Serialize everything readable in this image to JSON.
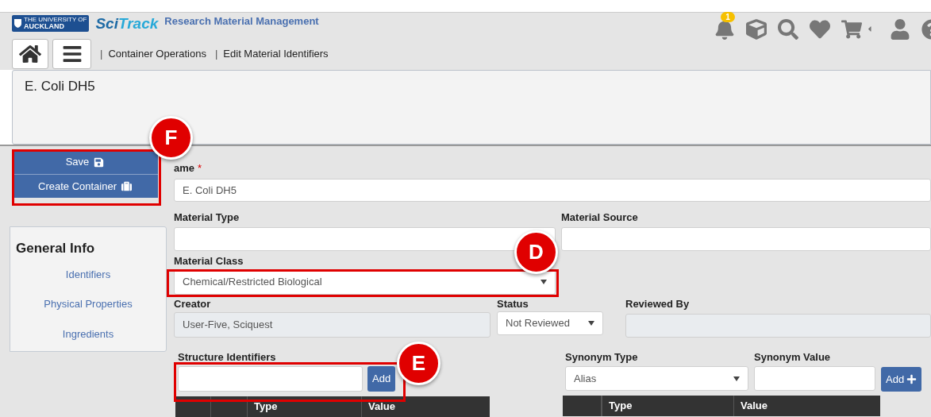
{
  "header": {
    "logo": {
      "line_1": "THE UNIVERSITY OF",
      "line_2": "AUCKLAND"
    },
    "brand": {
      "part_1": "Sci",
      "part_2": "Track"
    },
    "subtitle": "Research Material Management",
    "notification_count": "1",
    "breadcrumbs": [
      {
        "separator": "|",
        "label": "Container Operations"
      },
      {
        "separator": "|",
        "label": "Edit Material Identifiers"
      }
    ]
  },
  "title": "E. Coli DH5",
  "actions": [
    {
      "label": "Save",
      "kind": "save"
    },
    {
      "label": "Create Container",
      "kind": "container"
    }
  ],
  "sidebar": {
    "heading": "General Info",
    "items": [
      {
        "label": "Identifiers"
      },
      {
        "label": "Physical Properties"
      },
      {
        "label": "Ingredients"
      }
    ]
  },
  "form": {
    "name": {
      "label": "ame",
      "required_mark": "*",
      "value": "E. Coli DH5"
    },
    "material_type": {
      "label": "Material Type"
    },
    "material_source": {
      "label": "Material Source"
    },
    "material_class": {
      "label": "Material Class",
      "value": "Chemical/Restricted Biological"
    },
    "creator": {
      "label": "Creator",
      "value": "User-Five, Sciquest",
      "disabled": true
    },
    "status": {
      "label": "Status",
      "value": "Not Reviewed"
    },
    "reviewed_by": {
      "label": "Reviewed By",
      "disabled": true
    },
    "structure_identifiers": {
      "label": "Structure Identifiers",
      "button": "Add",
      "columns": [
        "Type",
        "Value"
      ]
    },
    "synonym_type": {
      "label": "Synonym Type",
      "value": "Alias"
    },
    "synonym_value": {
      "label": "Synonym Value",
      "button": "Add",
      "columns": [
        "Type",
        "Value"
      ]
    }
  },
  "callouts": [
    {
      "letter": "F"
    },
    {
      "letter": "D"
    },
    {
      "letter": "E"
    }
  ]
}
